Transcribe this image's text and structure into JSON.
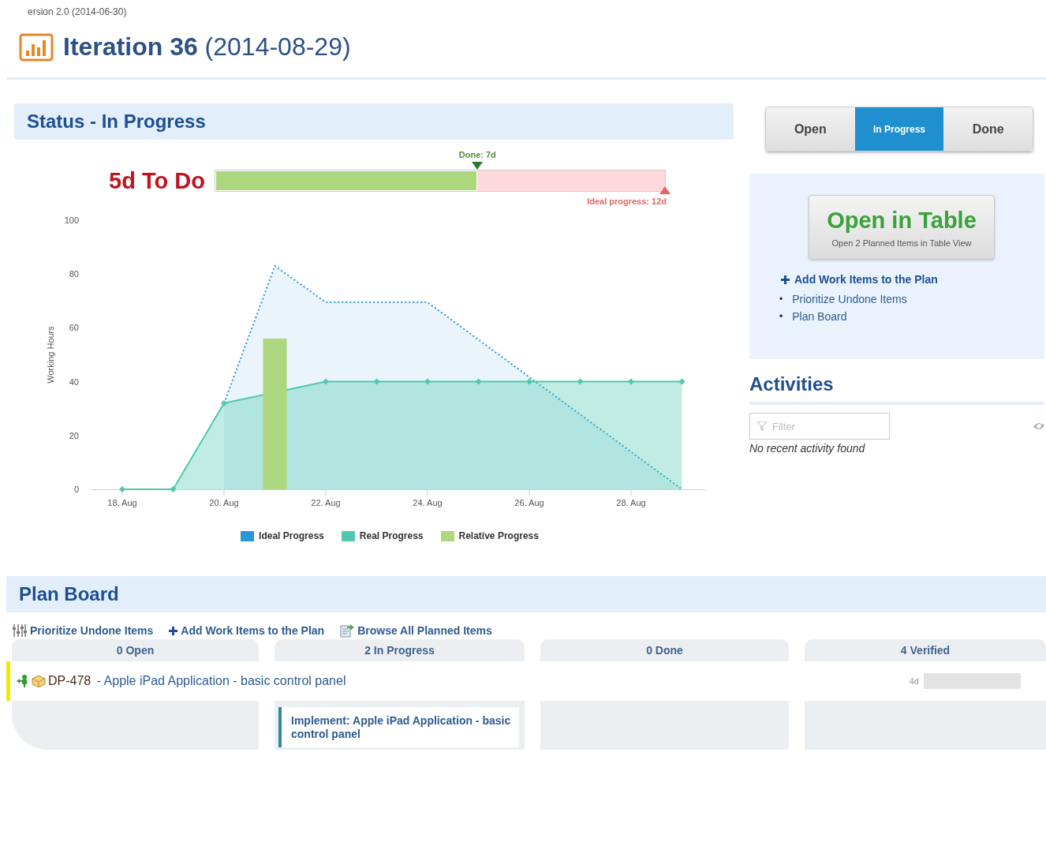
{
  "version": "ersion 2.0 (2014-06-30)",
  "title": {
    "name": "Iteration 36",
    "date": "(2014-08-29)"
  },
  "status": {
    "heading": "Status - In Progress",
    "todo": "5d To Do",
    "done_label": "Done: 7d",
    "done": {
      "level": 0.583
    },
    "ideal_label": "Ideal progress: 12d",
    "ideal": {
      "level": 1
    }
  },
  "chart_data": {
    "type": "area",
    "ylabel": "Working Hours",
    "categories": [
      "18. Aug",
      null,
      "20. Aug",
      null,
      "22. Aug",
      null,
      "24. Aug",
      null,
      "26. Aug",
      null,
      "28. Aug",
      null
    ],
    "ylim": [
      0,
      100
    ],
    "yticks": [
      0,
      20,
      40,
      60,
      80,
      100
    ],
    "series": [
      {
        "name": "Ideal Progress",
        "color": "#2b96d6",
        "values": [
          null,
          null,
          32,
          83,
          69.5,
          69.5,
          69.5,
          55.6,
          41.7,
          27.8,
          13.9,
          0
        ]
      },
      {
        "name": "Real Progress",
        "color": "#4ec9b0",
        "values": [
          0,
          0,
          32,
          null,
          40,
          40,
          40,
          40,
          40,
          40,
          40,
          40
        ]
      }
    ]
  },
  "relative_progress": {
    "name": "Relative Progress",
    "color": "#acd77f"
  },
  "state_tabs": [
    {
      "label": "Open",
      "selected": false
    },
    {
      "label": "In Progress",
      "selected": true
    },
    {
      "label": "Done",
      "selected": false
    }
  ],
  "actions": {
    "button_title": "Open in Table",
    "button_subtitle": "Open 2 Planned Items in Table View",
    "add_link": "Add Work Items to the Plan",
    "links": [
      {
        "bullet": "•",
        "label": "Prioritize Undone Items"
      },
      {
        "bullet": "•",
        "label": "Plan Board"
      }
    ]
  },
  "activities": {
    "heading": "Activities",
    "filter": {
      "placeholder": "Filter"
    },
    "empty": "No recent activity found"
  },
  "plan_board": {
    "heading": "Plan Board",
    "toolbar": [
      {
        "kind": "sliders",
        "label": "Prioritize Undone Items"
      },
      {
        "kind": "plus",
        "label": "Add Work Items to the Plan"
      },
      {
        "kind": "browse",
        "label": "Browse All Planned Items"
      }
    ],
    "item": {
      "key": "DP-478",
      "title": " - Apple iPad Application - basic control panel",
      "estimate": "4d",
      "progress": {
        "level": 0
      },
      "color": "#f5e800"
    },
    "columns": [
      {
        "label": "0 Open"
      },
      {
        "label": "2 In Progress",
        "cards": [
          {
            "title": "Implement: Apple iPad Application - basic control panel",
            "color": "#2a8b9a"
          }
        ]
      },
      {
        "label": "0 Done"
      },
      {
        "label": "4 Verified"
      }
    ]
  }
}
